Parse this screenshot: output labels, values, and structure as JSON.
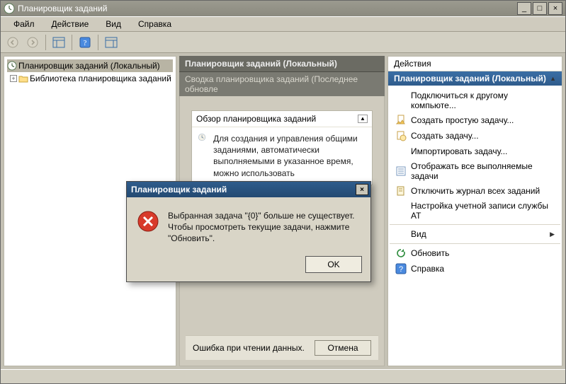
{
  "window": {
    "title": "Планировщик заданий"
  },
  "menu": {
    "file": "Файл",
    "action": "Действие",
    "view": "Вид",
    "help": "Справка"
  },
  "tree": {
    "root": "Планировщик заданий (Локальный)",
    "library": "Библиотека планировщика заданий"
  },
  "center": {
    "header": "Планировщик заданий (Локальный)",
    "subheader": "Сводка планировщика заданий (Последнее обновле",
    "summary_title": "Обзор планировщика заданий",
    "summary_text": "Для создания и управления общими заданиями, автоматически выполняемыми в указанное время, можно использовать",
    "footer_error": "Ошибка при чтении данных.",
    "cancel": "Отмена"
  },
  "actions": {
    "panel_label": "Действия",
    "title": "Планировщик заданий (Локальный)",
    "items": {
      "connect": "Подключиться к другому компьюте...",
      "create_basic": "Создать простую задачу...",
      "create": "Создать задачу...",
      "import": "Импортировать задачу...",
      "show_running": "Отображать все выполняемые задачи",
      "disable_log": "Отключить журнал всех заданий",
      "at_account": "Настройка учетной записи службы AT",
      "view": "Вид",
      "refresh": "Обновить",
      "help": "Справка"
    }
  },
  "dialog": {
    "title": "Планировщик заданий",
    "message": "Выбранная задача \"{0}\" больше не существует. Чтобы просмотреть текущие задачи, нажмите \"Обновить\".",
    "ok": "OK"
  }
}
